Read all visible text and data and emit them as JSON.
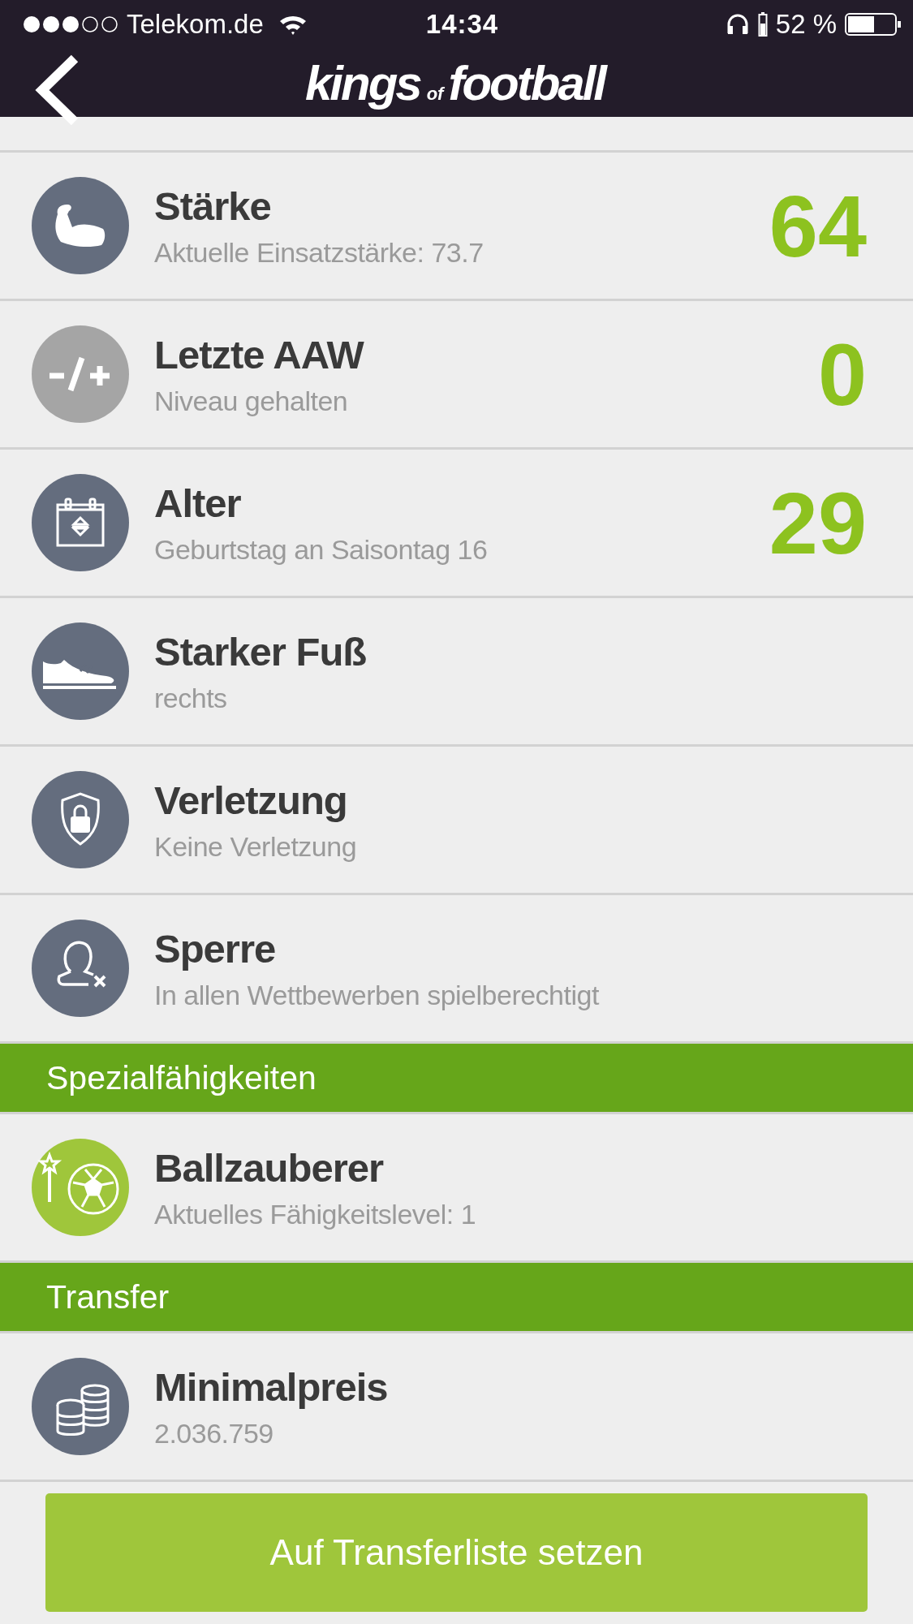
{
  "status_bar": {
    "carrier": "Telekom.de",
    "time": "14:34",
    "battery": "52 %"
  },
  "nav": {
    "logo": {
      "first": "kings",
      "middle": "of",
      "last": "football"
    }
  },
  "sections": [
    {
      "rows": [
        {
          "title": "Stärke",
          "subtitle": "Aktuelle Einsatzstärke: 73.7",
          "value": "64",
          "color": "#646d7e"
        },
        {
          "title": "Letzte AAW",
          "subtitle": "Niveau gehalten",
          "value": "0",
          "color": "#a5a5a5"
        },
        {
          "title": "Alter",
          "subtitle": "Geburtstag an Saisontag 16",
          "value": "29",
          "color": "#646d7e"
        },
        {
          "title": "Starker Fuß",
          "subtitle": "rechts",
          "color": "#646d7e"
        },
        {
          "title": "Verletzung",
          "subtitle": "Keine Verletzung",
          "color": "#646d7e"
        },
        {
          "title": "Sperre",
          "subtitle": "In allen Wettbewerben spielberechtigt",
          "color": "#646d7e"
        }
      ]
    },
    {
      "title": "Spezialfähigkeiten",
      "rows": [
        {
          "title": "Ballzauberer",
          "subtitle": "Aktuelles Fähigkeitslevel: 1",
          "color": "#9fc63b"
        }
      ]
    },
    {
      "title": "Transfer",
      "rows": [
        {
          "title": "Minimalpreis",
          "subtitle": "2.036.759",
          "color": "#646d7e"
        }
      ]
    }
  ],
  "button": {
    "label": "Auf Transferliste setzen"
  }
}
